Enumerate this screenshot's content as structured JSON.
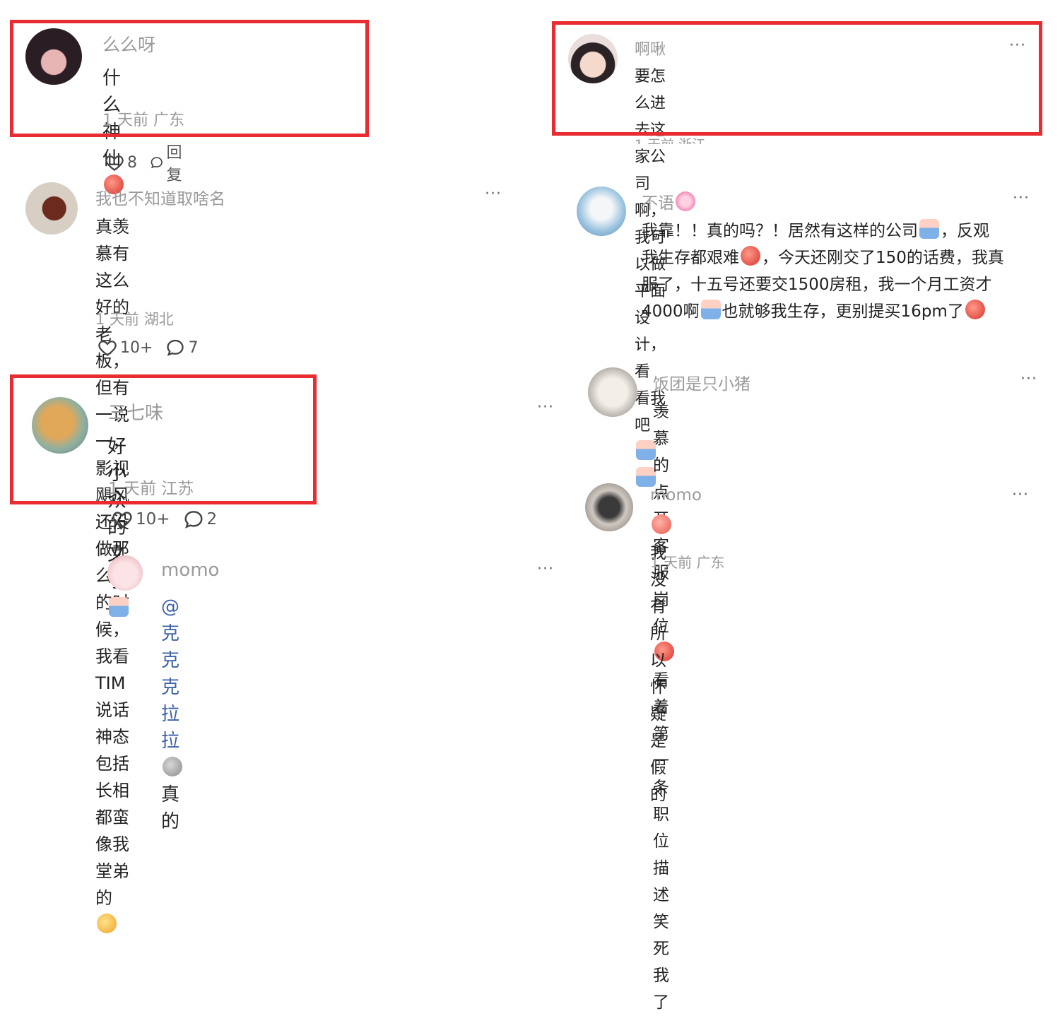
{
  "colors": {
    "highlight_box": "#e82c31",
    "username": "#9a9a9a",
    "mention": "#3b5fa8"
  },
  "left": {
    "c1": {
      "user": "么么呀",
      "text": "什么神仙",
      "meta": "1 天前 广东",
      "likes": "8",
      "reply_label": "回复"
    },
    "c2": {
      "user": "我也不知道取啥名",
      "line1": "真羡慕有这么好的老板，但有一说一，影视飓风",
      "line2": "还没做那么大的时候，我看TIM说话神态包括长相",
      "line3": "都蛮像我堂弟的",
      "meta": "1 天前 湖北",
      "likes": "10+",
      "replies": "7",
      "more": "···"
    },
    "c3": {
      "user": "三七味",
      "text": "好小众的文字",
      "meta": "1 天前 江苏",
      "likes": "10+",
      "replies": "2",
      "more": "···"
    },
    "c4": {
      "user": "momo",
      "mention": "@克克克拉拉",
      "text": "真的",
      "more": "···"
    }
  },
  "right": {
    "c1": {
      "user": "啊啾",
      "line1": "要怎么进去这家公司啊，我可以做平面设计，看",
      "line2": "看我吧",
      "meta": "1 天前 浙江",
      "more": "···"
    },
    "c2": {
      "user": "不语",
      "line1a": "我靠！！真的吗？！居然有这样的公司",
      "line1b": "，反观",
      "line2a": "我生存都艰难",
      "line2b": "，今天还刚交了150的话费，我真",
      "line3": "服了，十五号还要交1500房租，我一个月工资才",
      "line4a": "4000啊",
      "line4b": "也就够我生存，更别提买16pm了",
      "more": "···"
    },
    "c3": {
      "user": "饭团是只小猪",
      "line1a": "羡慕的点开客服岗位",
      "line1b": "看着第一条职位描述笑死",
      "line2": "我了",
      "more": "···"
    },
    "c4": {
      "user": "momo",
      "text": "我没有所以怀疑是假的",
      "meta": "1 天前 广东",
      "more": "···"
    }
  }
}
